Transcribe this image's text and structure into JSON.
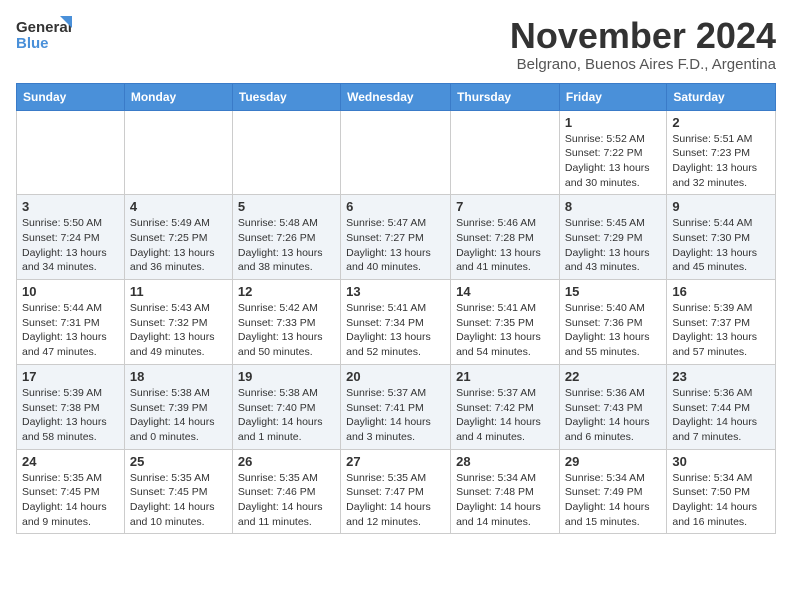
{
  "logo": {
    "general": "General",
    "blue": "Blue"
  },
  "title": "November 2024",
  "subtitle": "Belgrano, Buenos Aires F.D., Argentina",
  "weekdays": [
    "Sunday",
    "Monday",
    "Tuesday",
    "Wednesday",
    "Thursday",
    "Friday",
    "Saturday"
  ],
  "weeks": [
    [
      {
        "day": "",
        "info": ""
      },
      {
        "day": "",
        "info": ""
      },
      {
        "day": "",
        "info": ""
      },
      {
        "day": "",
        "info": ""
      },
      {
        "day": "",
        "info": ""
      },
      {
        "day": "1",
        "info": "Sunrise: 5:52 AM\nSunset: 7:22 PM\nDaylight: 13 hours and 30 minutes."
      },
      {
        "day": "2",
        "info": "Sunrise: 5:51 AM\nSunset: 7:23 PM\nDaylight: 13 hours and 32 minutes."
      }
    ],
    [
      {
        "day": "3",
        "info": "Sunrise: 5:50 AM\nSunset: 7:24 PM\nDaylight: 13 hours and 34 minutes."
      },
      {
        "day": "4",
        "info": "Sunrise: 5:49 AM\nSunset: 7:25 PM\nDaylight: 13 hours and 36 minutes."
      },
      {
        "day": "5",
        "info": "Sunrise: 5:48 AM\nSunset: 7:26 PM\nDaylight: 13 hours and 38 minutes."
      },
      {
        "day": "6",
        "info": "Sunrise: 5:47 AM\nSunset: 7:27 PM\nDaylight: 13 hours and 40 minutes."
      },
      {
        "day": "7",
        "info": "Sunrise: 5:46 AM\nSunset: 7:28 PM\nDaylight: 13 hours and 41 minutes."
      },
      {
        "day": "8",
        "info": "Sunrise: 5:45 AM\nSunset: 7:29 PM\nDaylight: 13 hours and 43 minutes."
      },
      {
        "day": "9",
        "info": "Sunrise: 5:44 AM\nSunset: 7:30 PM\nDaylight: 13 hours and 45 minutes."
      }
    ],
    [
      {
        "day": "10",
        "info": "Sunrise: 5:44 AM\nSunset: 7:31 PM\nDaylight: 13 hours and 47 minutes."
      },
      {
        "day": "11",
        "info": "Sunrise: 5:43 AM\nSunset: 7:32 PM\nDaylight: 13 hours and 49 minutes."
      },
      {
        "day": "12",
        "info": "Sunrise: 5:42 AM\nSunset: 7:33 PM\nDaylight: 13 hours and 50 minutes."
      },
      {
        "day": "13",
        "info": "Sunrise: 5:41 AM\nSunset: 7:34 PM\nDaylight: 13 hours and 52 minutes."
      },
      {
        "day": "14",
        "info": "Sunrise: 5:41 AM\nSunset: 7:35 PM\nDaylight: 13 hours and 54 minutes."
      },
      {
        "day": "15",
        "info": "Sunrise: 5:40 AM\nSunset: 7:36 PM\nDaylight: 13 hours and 55 minutes."
      },
      {
        "day": "16",
        "info": "Sunrise: 5:39 AM\nSunset: 7:37 PM\nDaylight: 13 hours and 57 minutes."
      }
    ],
    [
      {
        "day": "17",
        "info": "Sunrise: 5:39 AM\nSunset: 7:38 PM\nDaylight: 13 hours and 58 minutes."
      },
      {
        "day": "18",
        "info": "Sunrise: 5:38 AM\nSunset: 7:39 PM\nDaylight: 14 hours and 0 minutes."
      },
      {
        "day": "19",
        "info": "Sunrise: 5:38 AM\nSunset: 7:40 PM\nDaylight: 14 hours and 1 minute."
      },
      {
        "day": "20",
        "info": "Sunrise: 5:37 AM\nSunset: 7:41 PM\nDaylight: 14 hours and 3 minutes."
      },
      {
        "day": "21",
        "info": "Sunrise: 5:37 AM\nSunset: 7:42 PM\nDaylight: 14 hours and 4 minutes."
      },
      {
        "day": "22",
        "info": "Sunrise: 5:36 AM\nSunset: 7:43 PM\nDaylight: 14 hours and 6 minutes."
      },
      {
        "day": "23",
        "info": "Sunrise: 5:36 AM\nSunset: 7:44 PM\nDaylight: 14 hours and 7 minutes."
      }
    ],
    [
      {
        "day": "24",
        "info": "Sunrise: 5:35 AM\nSunset: 7:45 PM\nDaylight: 14 hours and 9 minutes."
      },
      {
        "day": "25",
        "info": "Sunrise: 5:35 AM\nSunset: 7:45 PM\nDaylight: 14 hours and 10 minutes."
      },
      {
        "day": "26",
        "info": "Sunrise: 5:35 AM\nSunset: 7:46 PM\nDaylight: 14 hours and 11 minutes."
      },
      {
        "day": "27",
        "info": "Sunrise: 5:35 AM\nSunset: 7:47 PM\nDaylight: 14 hours and 12 minutes."
      },
      {
        "day": "28",
        "info": "Sunrise: 5:34 AM\nSunset: 7:48 PM\nDaylight: 14 hours and 14 minutes."
      },
      {
        "day": "29",
        "info": "Sunrise: 5:34 AM\nSunset: 7:49 PM\nDaylight: 14 hours and 15 minutes."
      },
      {
        "day": "30",
        "info": "Sunrise: 5:34 AM\nSunset: 7:50 PM\nDaylight: 14 hours and 16 minutes."
      }
    ]
  ]
}
